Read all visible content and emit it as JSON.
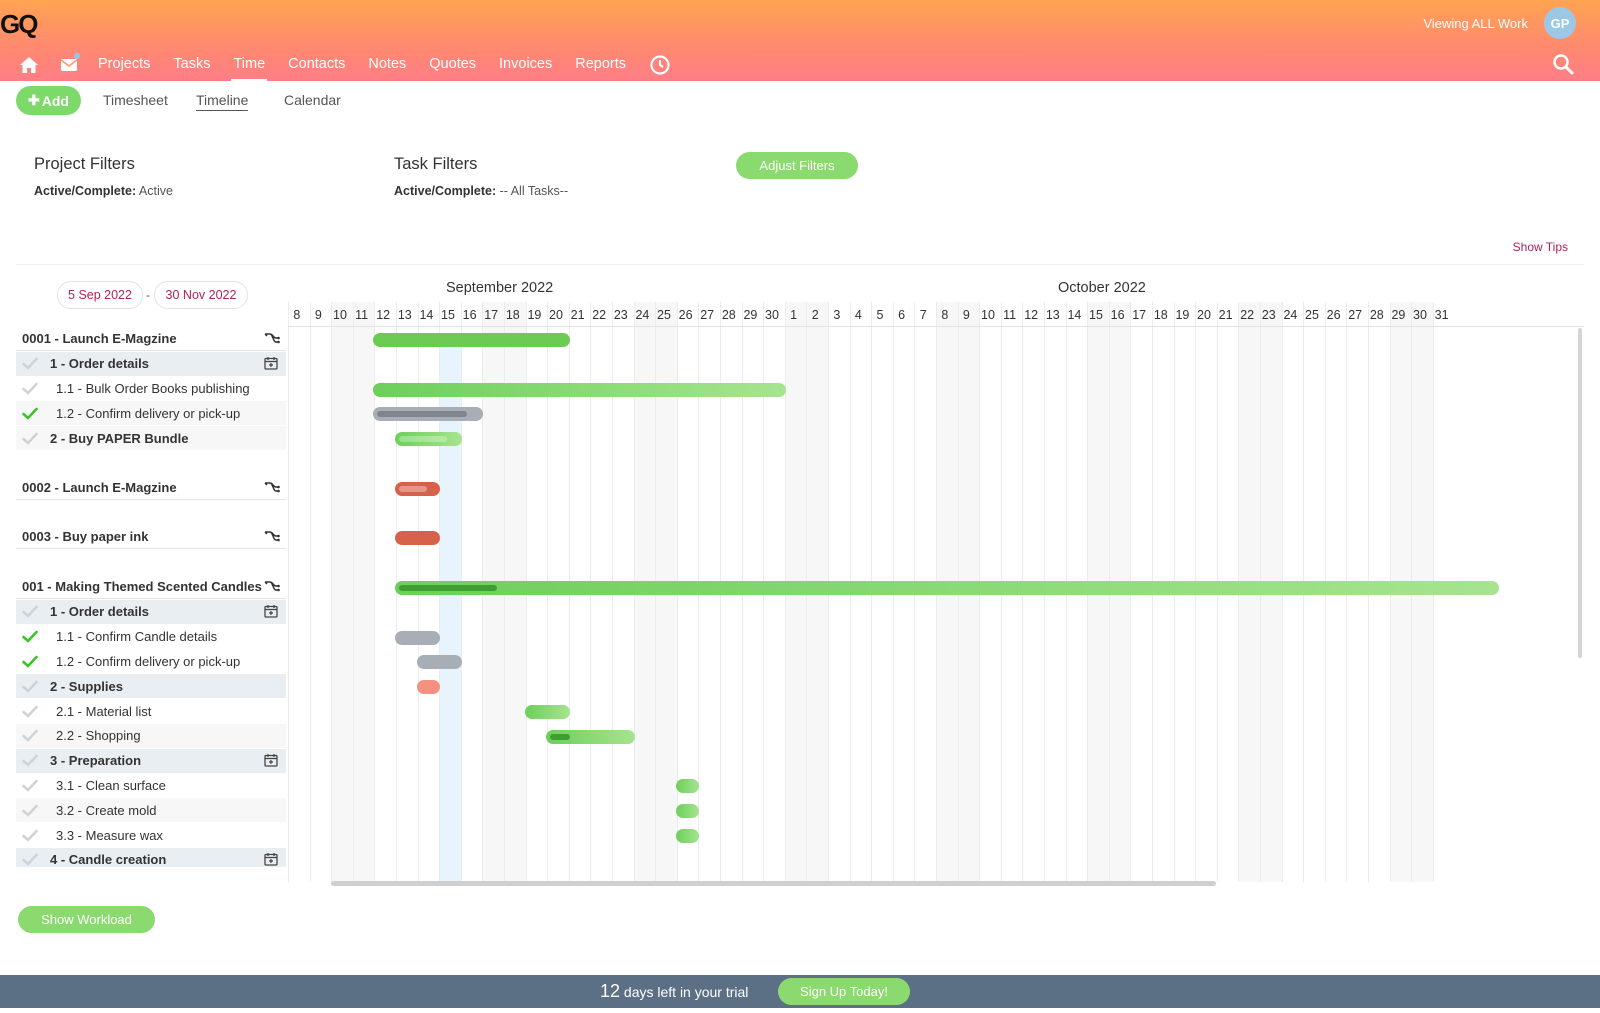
{
  "header": {
    "logo_text": "GQ",
    "viewing": "Viewing ALL Work",
    "avatar_initials": "GP",
    "nav": [
      {
        "label": "Projects"
      },
      {
        "label": "Tasks"
      },
      {
        "label": "Time",
        "active": true
      },
      {
        "label": "Contacts"
      },
      {
        "label": "Notes"
      },
      {
        "label": "Quotes"
      },
      {
        "label": "Invoices"
      },
      {
        "label": "Reports"
      }
    ]
  },
  "subnav": {
    "add_label": "Add",
    "tabs": [
      {
        "label": "Timesheet"
      },
      {
        "label": "Timeline",
        "active": true
      },
      {
        "label": "Calendar"
      }
    ]
  },
  "filters": {
    "project_title": "Project Filters",
    "project_label": "Active/Complete:",
    "project_value": "Active",
    "task_title": "Task Filters",
    "task_label": "Active/Complete:",
    "task_value": "-- All Tasks--",
    "adjust_label": "Adjust Filters",
    "show_tips": "Show Tips"
  },
  "date_range": {
    "start": "5 Sep 2022",
    "separator": "-",
    "end": "30 Nov 2022"
  },
  "timeline": {
    "months": [
      {
        "label": "September 2022",
        "start_day_index": 7
      },
      {
        "label": "October 2022",
        "start_day_index": 35
      }
    ],
    "days": [
      "8",
      "9",
      "10",
      "11",
      "12",
      "13",
      "14",
      "15",
      "16",
      "17",
      "18",
      "19",
      "20",
      "21",
      "22",
      "23",
      "24",
      "25",
      "26",
      "27",
      "28",
      "29",
      "30",
      "1",
      "2",
      "3",
      "4",
      "5",
      "6",
      "7",
      "8",
      "9",
      "10",
      "11",
      "12",
      "13",
      "14",
      "15",
      "16",
      "17",
      "18",
      "19",
      "20",
      "21",
      "22",
      "23",
      "24",
      "25",
      "26",
      "27",
      "28",
      "29",
      "30",
      "31"
    ],
    "today_index": 7
  },
  "rows": [
    {
      "kind": "project",
      "label": "0001 - Launch E-Magzine",
      "icon": "hierarchy-icon",
      "bar": {
        "start": 4,
        "end": 13,
        "color": "greendark"
      }
    },
    {
      "kind": "task",
      "label": "1 - Order details",
      "check": "grey",
      "icon": "calendar-icon"
    },
    {
      "kind": "sub",
      "label": "1.1 - Bulk Order Books publishing",
      "check": "grey",
      "bar": {
        "start": 4,
        "end": 23,
        "color": "green"
      }
    },
    {
      "kind": "sub",
      "label": "1.2 - Confirm delivery or pick-up",
      "check": "green",
      "alt": true,
      "bar": {
        "start": 4,
        "end": 9,
        "color": "grey",
        "progress": 0.9
      }
    },
    {
      "kind": "taskplain",
      "label": "2 - Buy PAPER Bundle",
      "check": "grey",
      "bar": {
        "start": 5,
        "end": 8,
        "color": "green",
        "progress": 0.85
      }
    },
    {
      "kind": "project",
      "label": "0002 - Launch E-Magzine",
      "icon": "hierarchy-icon",
      "gap": true,
      "bar": {
        "start": 5,
        "end": 7,
        "color": "red",
        "progress": 0.8
      }
    },
    {
      "kind": "project",
      "label": "0003 - Buy paper ink",
      "icon": "hierarchy-icon",
      "gap": true,
      "bar": {
        "start": 5,
        "end": 7,
        "color": "red"
      }
    },
    {
      "kind": "project",
      "label": "001 - Making Themed Scented Candles",
      "icon": "hierarchy-icon",
      "gap": true,
      "bar": {
        "start": 5,
        "end": 56,
        "color": "green",
        "progress": 0.09
      }
    },
    {
      "kind": "task",
      "label": "1 - Order details",
      "check": "grey",
      "icon": "calendar-icon"
    },
    {
      "kind": "sub",
      "label": "1.1 - Confirm Candle details",
      "check": "green",
      "bar": {
        "start": 5,
        "end": 7,
        "color": "grey"
      }
    },
    {
      "kind": "sub",
      "label": "1.2 - Confirm delivery or pick-up",
      "check": "green",
      "bar": {
        "start": 6,
        "end": 8,
        "color": "grey"
      }
    },
    {
      "kind": "task",
      "label": "2 - Supplies",
      "check": "grey",
      "bar": {
        "start": 6,
        "end": 7,
        "color": "salmon"
      }
    },
    {
      "kind": "sub",
      "label": "2.1 - Material list",
      "check": "grey",
      "bar": {
        "start": 11,
        "end": 13,
        "color": "green"
      }
    },
    {
      "kind": "sub",
      "label": "2.2 - Shopping",
      "check": "grey",
      "alt": true,
      "bar": {
        "start": 12,
        "end": 16,
        "color": "green",
        "progress": 0.25
      }
    },
    {
      "kind": "task",
      "label": "3 - Preparation",
      "check": "grey",
      "icon": "calendar-icon"
    },
    {
      "kind": "sub",
      "label": "3.1 - Clean surface",
      "check": "grey",
      "bar": {
        "start": 18,
        "end": 19,
        "color": "green"
      }
    },
    {
      "kind": "sub",
      "label": "3.2 - Create mold",
      "check": "grey",
      "alt": true,
      "bar": {
        "start": 18,
        "end": 19,
        "color": "green"
      }
    },
    {
      "kind": "sub",
      "label": "3.3 - Measure wax",
      "check": "grey",
      "bar": {
        "start": 18,
        "end": 19,
        "color": "green"
      }
    },
    {
      "kind": "task",
      "label": "4 - Candle creation",
      "check": "grey",
      "icon": "calendar-icon"
    }
  ],
  "workload_label": "Show Workload",
  "footer": {
    "days_left": "12",
    "trial_text": "days left in your trial",
    "signup_label": "Sign Up Today!"
  },
  "colors": {
    "accent_green": "#8ada6f",
    "header_from": "#ffa452",
    "header_to": "#ff7e86",
    "link_red": "#b0235a",
    "footer": "#5b6f85"
  }
}
